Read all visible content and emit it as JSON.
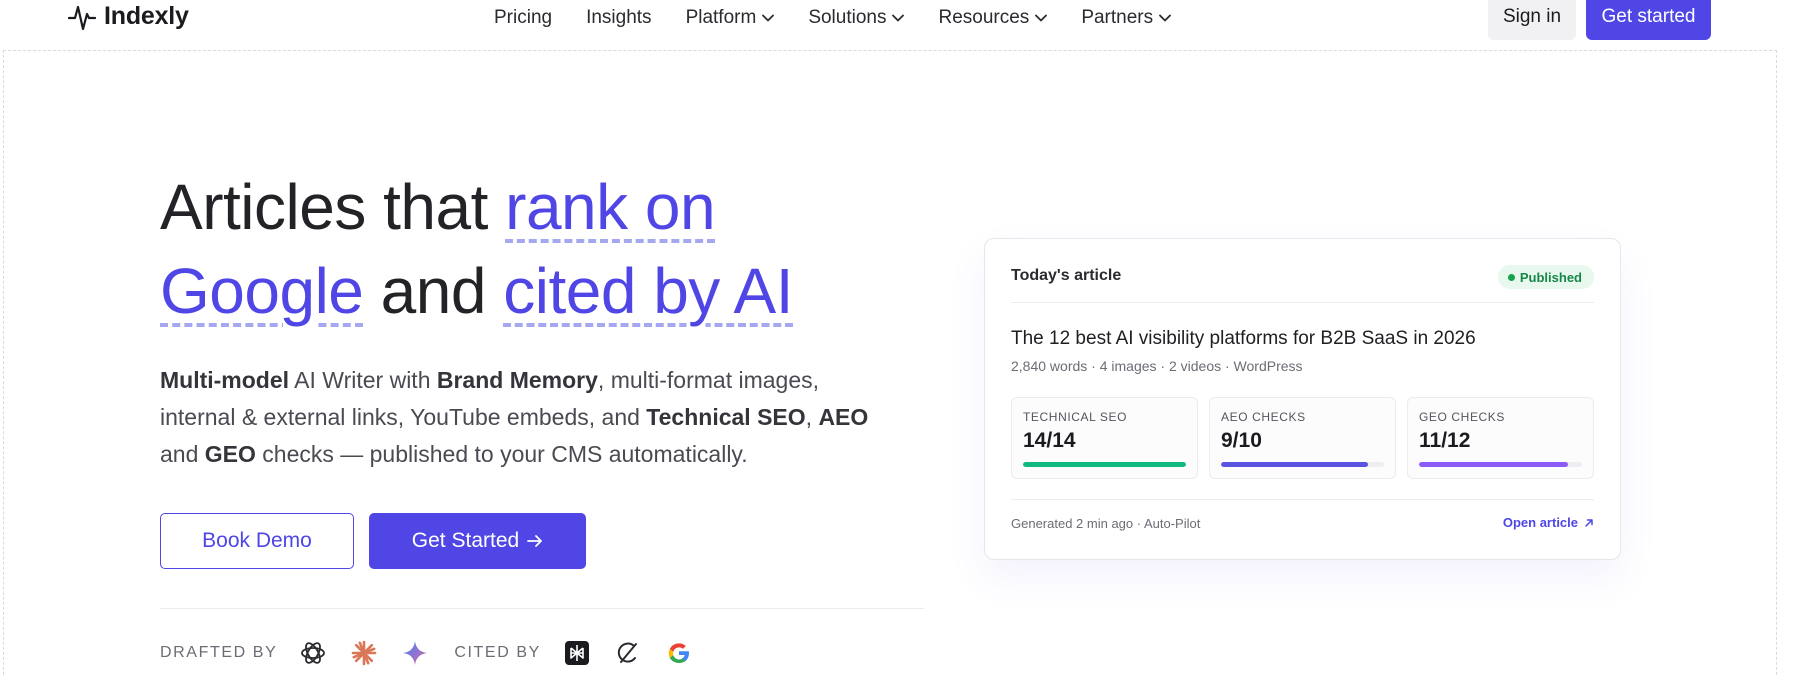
{
  "header": {
    "brand": "Indexly",
    "nav": [
      {
        "label": "Pricing",
        "dropdown": false
      },
      {
        "label": "Insights",
        "dropdown": false
      },
      {
        "label": "Platform",
        "dropdown": true
      },
      {
        "label": "Solutions",
        "dropdown": true
      },
      {
        "label": "Resources",
        "dropdown": true
      },
      {
        "label": "Partners",
        "dropdown": true
      }
    ],
    "sign_in": "Sign in",
    "get_started": "Get started"
  },
  "hero": {
    "headline": {
      "part1": "Articles that ",
      "highlight1": "rank on",
      "highlight2": "Google",
      "part2": " and ",
      "highlight3": "cited by AI"
    },
    "sub": {
      "b1": "Multi-model",
      "t1": " AI Writer with ",
      "b2": "Brand Memory",
      "t2": ", multi-format images, internal & external links, YouTube embeds, and ",
      "b3": "Technical SEO",
      "t3": ", ",
      "b4": "AEO",
      "t4": " and ",
      "b5": "GEO",
      "t5": " checks — published to your CMS automatically."
    },
    "book_demo": "Book Demo",
    "get_started": "Get Started",
    "drafted_by": "DRAFTED BY",
    "cited_by": "CITED BY"
  },
  "card": {
    "label": "Today's article",
    "status": "Published",
    "title": "The 12 best AI visibility platforms for B2B SaaS in 2026",
    "meta": "2,840 words · 4 images · 2 videos · WordPress",
    "checks": [
      {
        "label": "TECHNICAL SEO",
        "value": "14/14",
        "progress": 1.0,
        "color": "#10b981"
      },
      {
        "label": "AEO CHECKS",
        "value": "9/10",
        "progress": 0.9,
        "color": "#5b54e0"
      },
      {
        "label": "GEO CHECKS",
        "value": "11/12",
        "progress": 0.917,
        "color": "#8b5cf6"
      }
    ],
    "footer": "Generated 2 min ago · Auto-Pilot",
    "open_link": "Open article"
  },
  "colors": {
    "accent": "#4f46e5",
    "published": "#16a34a"
  }
}
